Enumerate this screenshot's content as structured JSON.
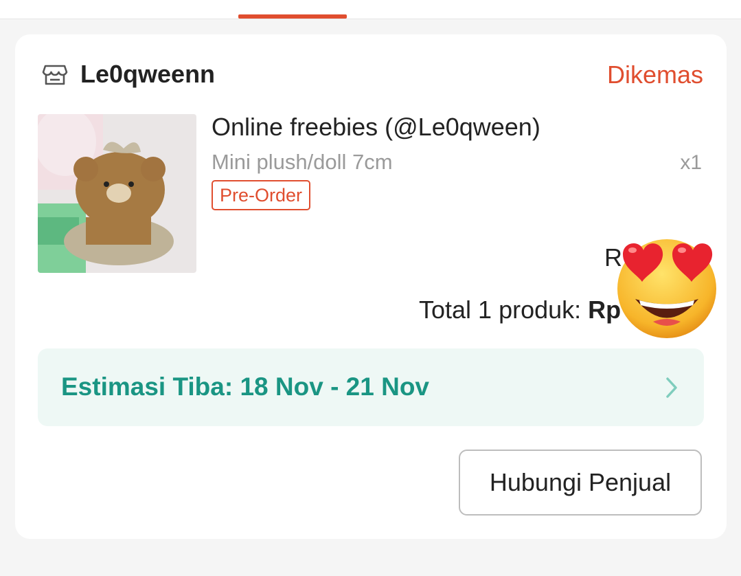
{
  "shop": {
    "name": "Le0qweenn",
    "icon": "shop-icon",
    "status": "Dikemas"
  },
  "product": {
    "title": "Online freebies (@Le0qween)",
    "variant": "Mini plush/doll 7cm",
    "quantity": "x1",
    "badge": "Pre-Order",
    "price_partial": "R"
  },
  "total": {
    "label": "Total 1 produk:",
    "value_partial": "Rp"
  },
  "delivery": {
    "estimate": "Estimasi Tiba: 18 Nov - 21 Nov",
    "icon": "chevron-right-icon"
  },
  "actions": {
    "contact_seller": "Hubungi Penjual"
  },
  "colors": {
    "accent": "#e04e2f",
    "eta_text": "#1a9583",
    "eta_bg": "#eef8f5"
  }
}
